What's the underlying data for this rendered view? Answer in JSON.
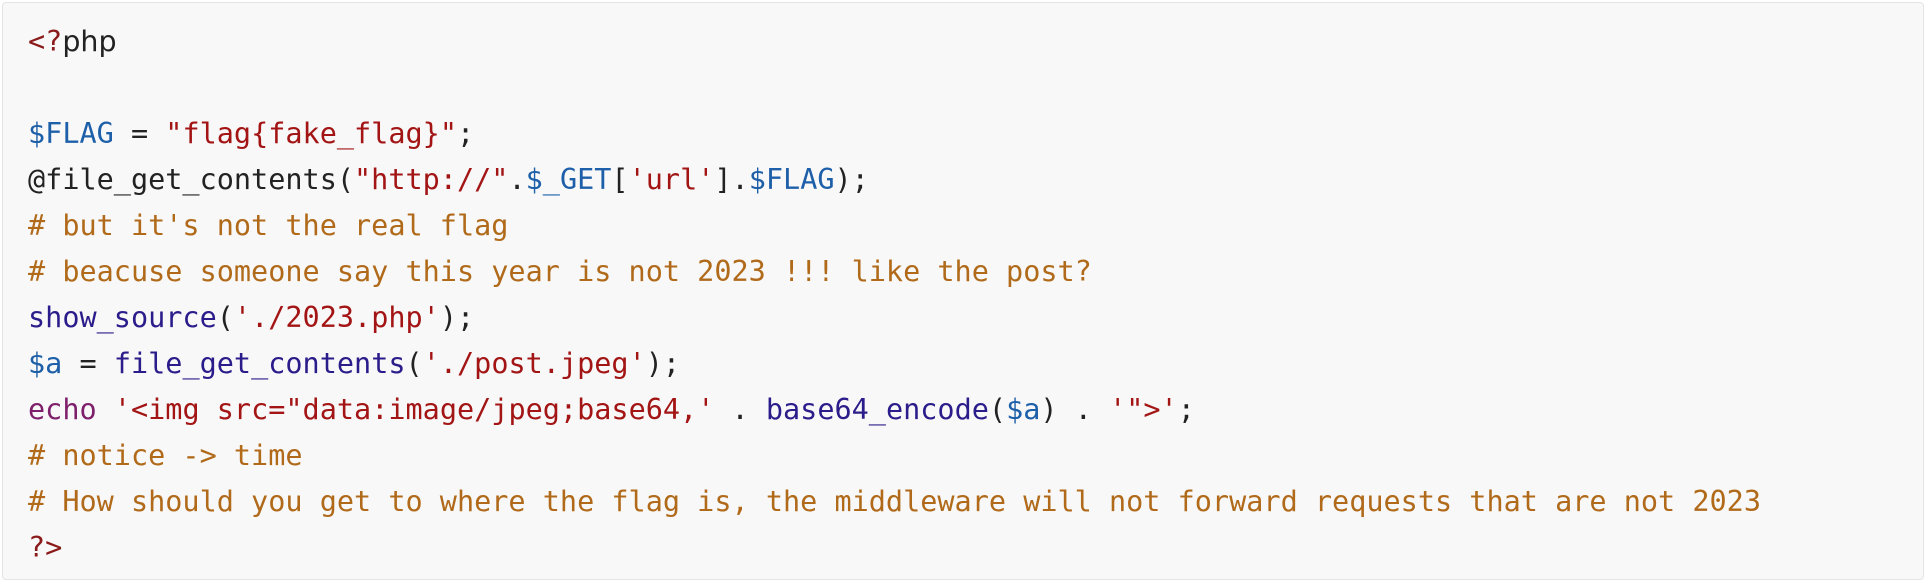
{
  "code": {
    "open_tag": "<?",
    "php_word": "php",
    "flag_var": "$FLAG",
    "flag_eq": " = ",
    "flag_value": "\"flag{fake_flag}\"",
    "semi": ";",
    "fgc_prefix": "@file_get_contents(",
    "fgc_http": "\"http://\"",
    "dot": ".",
    "get_var": "$_GET",
    "bracket_open": "[",
    "url_key": "'url'",
    "bracket_close": "].",
    "fgc_end": ");",
    "comment_1": "# but it's not the real flag",
    "comment_2": "# beacuse someone say this year is not 2023 !!! like the post?",
    "show_source_fn": "show_source",
    "paren_open": "(",
    "show_source_arg": "'./2023.php'",
    "a_var": "$a",
    "file_get_contents_fn": "file_get_contents",
    "post_arg": "'./post.jpeg'",
    "echo_kw": "echo",
    "img_str": "'<img src=\"data:image/jpeg;base64,'",
    "concat": " . ",
    "base64_fn": "base64_encode",
    "paren_close": ")",
    "img_end": "'\">'",
    "comment_3": "# notice -> time",
    "comment_4": "# How should you get to where the flag is, the middleware will not forward requests that are not 2023",
    "close_tag": "?>"
  }
}
